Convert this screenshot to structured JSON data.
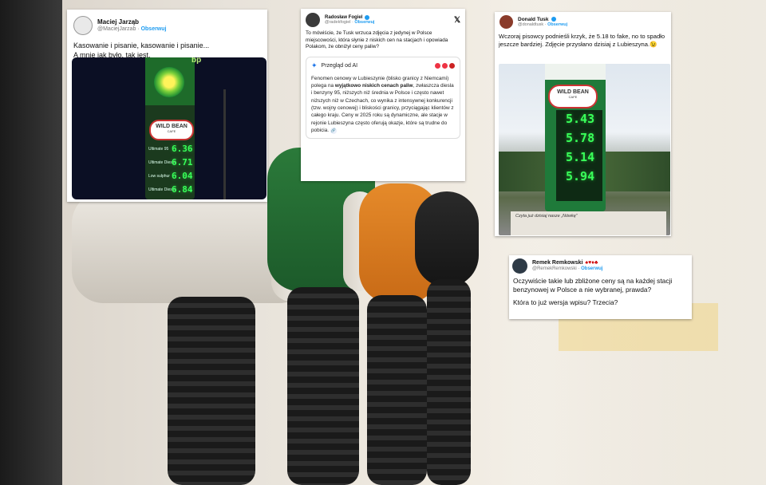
{
  "cards": {
    "c1": {
      "name": "Maciej Jarząb",
      "handle": "@MaciejJarzab",
      "follow": "Obserwuj",
      "line1": "Kasowanie i pisanie, kasowanie i pisanie...",
      "line2": "A mnie jak było, tak jest.",
      "brand": "bp",
      "cafe": "WILD BEAN",
      "cafe_sub": "CAFE",
      "prices": [
        "6.36",
        "6.71",
        "6.04",
        "6.84"
      ],
      "fuel_labels": [
        "Ultimate 95",
        "Ultimate Diesel",
        "Low sulphur",
        "Ultimate Diesel"
      ]
    },
    "c2": {
      "name": "Radosław Fogiel",
      "handle": "@radekfogiel",
      "follow": "Obserwuj",
      "intro": "To mówiście, że Tusk wrzuca zdjęcia z jedynej w Polsce miejscowości, która słynie z niskich cen na stacjach i opowiada Polakom, że obniżył ceny paliw?",
      "ai_title": "Przegląd od AI",
      "ai_p1": "Fenomen cenowy w Lubieszynie (blisko granicy z Niemcami) polega na ",
      "ai_bold": "wyjątkowo niskich cenach paliw",
      "ai_p2": ", zwłaszcza diesla i benzyny 95, niższych niż średnia w Polsce i często nawet niższych niż w Czechach, co wynika z intensywnej konkurencji (tzw. wojny cenowej) i bliskości granicy, przyciągając klientów z całego kraju. Ceny w 2025 roku są dynamiczne, ale stacje w rejonie Lubieszyna często oferują okazje, które są trudne do pobicia."
    },
    "c3": {
      "name": "Donald Tusk",
      "handle": "@donaldtusk",
      "follow": "Obserwuj",
      "text": "Wczoraj pisowcy podnieśli krzyk, że 5.18 to fake, no to spadło jeszcze bardziej. Zdjęcie przysłano dzisiaj z Lubieszyna.😉",
      "cafe": "WILD BEAN",
      "cafe_sub": "CAFE",
      "prices": [
        "5.43",
        "5.78",
        "5.14",
        "5.94"
      ],
      "paper": "Czyta już dzisiaj nasze „Nówkę”"
    },
    "c4": {
      "name": "Remek Remkowski",
      "suits": "♠♥♦♣",
      "handle": "@RemekRemkowski",
      "follow": "Obserwuj",
      "p1": "Oczywiście takie lub zbliżone ceny są na każdej stacji benzynowej w Polsce a nie wybranej, prawda?",
      "p2": "Która to już wersja wpisu? Trzecia?"
    }
  },
  "icons": {
    "verified": "verified-badge-icon",
    "x_logo": "x-logo-icon",
    "ai": "ai-sparkle-icon"
  },
  "colors": {
    "link": "#1d9bf0",
    "price_green": "#39ff5a"
  }
}
